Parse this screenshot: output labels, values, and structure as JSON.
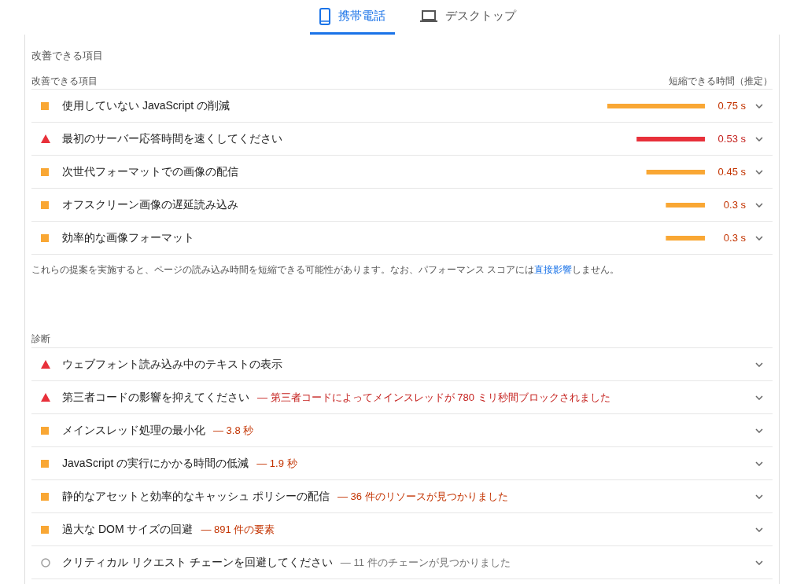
{
  "tabs": [
    {
      "label": "携帯電話",
      "selected": true
    },
    {
      "label": "デスクトップ",
      "selected": false
    }
  ],
  "opportunities": {
    "title": "改善できる項目",
    "header": {
      "left": "改善できる項目",
      "right": "短縮できる時間（推定）"
    },
    "items": [
      {
        "kind": "average",
        "title": "使用していない JavaScript の削減",
        "level": 1,
        "savings": "0.75 s"
      },
      {
        "kind": "fail",
        "title": "最初のサーバー応答時間を速くしてください",
        "level": 0.7,
        "savings": "0.53 s"
      },
      {
        "kind": "average",
        "title": "次世代フォーマットでの画像の配信",
        "level": 0.6,
        "savings": "0.45 s"
      },
      {
        "kind": "average",
        "title": "オフスクリーン画像の遅延読み込み",
        "level": 0.4,
        "savings": "0.3 s"
      },
      {
        "kind": "average",
        "title": "効率的な画像フォーマット",
        "level": 0.4,
        "savings": "0.3 s"
      }
    ],
    "footnote": {
      "text": "これらの提案を実施すると、ページの読み込み時間を短縮できる可能性があります。なお、パフォーマンス スコアには",
      "link": "直接影響",
      "after": "しません。"
    }
  },
  "diagnostics": {
    "title": "診断",
    "items": [
      {
        "kind": "fail",
        "title": "ウェブフォント読み込み中のテキストの表示"
      },
      {
        "kind": "fail",
        "title": "第三者コードの影響を抑えてください",
        "detail": "— 第三者コードによってメインスレッドが 780 ミリ秒間ブロックされました"
      },
      {
        "kind": "average",
        "title": "メインスレッド処理の最小化",
        "detail": "— 3.8 秒"
      },
      {
        "kind": "average",
        "title": "JavaScript の実行にかかる時間の低減",
        "detail": "— 1.9 秒"
      },
      {
        "kind": "average",
        "title": "静的なアセットと効率的なキャッシュ ポリシーの配信",
        "detail": "— 36 件のリソースが見つかりました"
      },
      {
        "kind": "average",
        "title": "過大な DOM サイズの回避",
        "detail": "— 891 件の要素"
      },
      {
        "kind": "info",
        "title": "クリティカル リクエスト チェーンを回避してください",
        "detail": "— 11 件のチェーンが見つかりました"
      }
    ]
  }
}
